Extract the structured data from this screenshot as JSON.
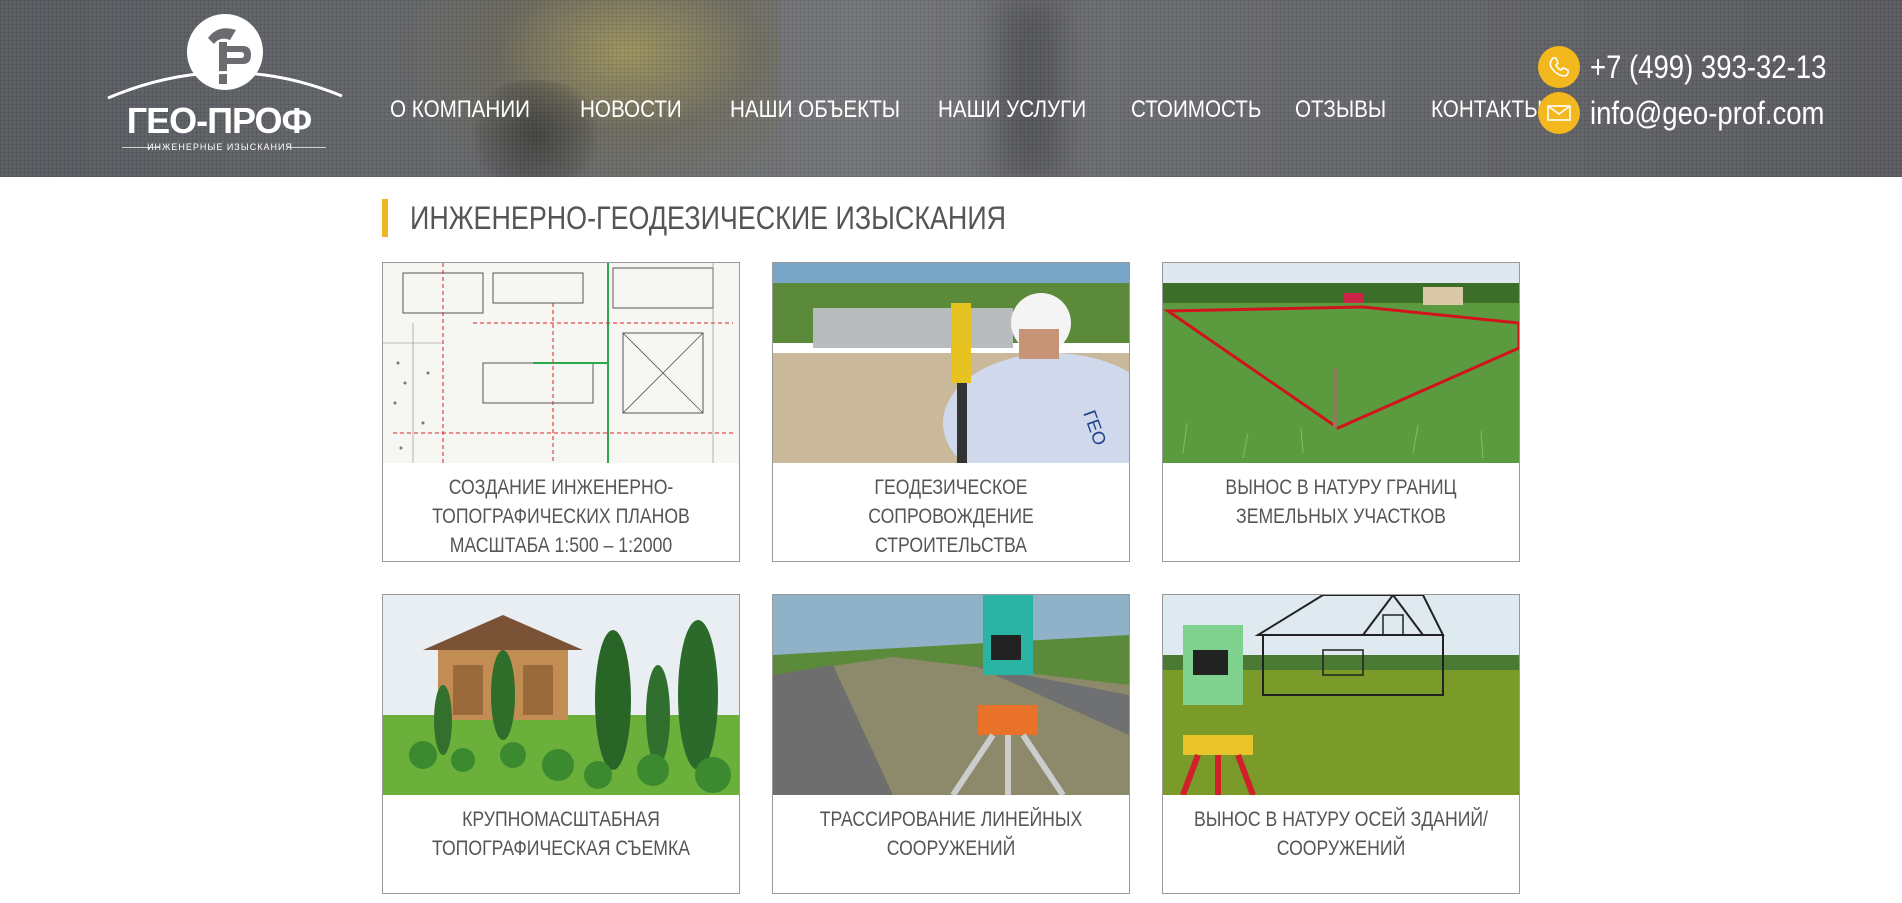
{
  "site": {
    "logo_text": "ГЕО-ПРОФ",
    "logo_subtitle": "ИНЖЕНЕРНЫЕ ИЗЫСКАНИЯ"
  },
  "nav": {
    "items": [
      {
        "label": "О КОМПАНИИ"
      },
      {
        "label": "НОВОСТИ"
      },
      {
        "label": "НАШИ ОБЪЕКТЫ"
      },
      {
        "label": "НАШИ УСЛУГИ"
      },
      {
        "label": "СТОИМОСТЬ"
      },
      {
        "label": "ОТЗЫВЫ"
      },
      {
        "label": "КОНТАКТЫ"
      }
    ]
  },
  "contacts": {
    "phone": "+7 (499) 393-32-13",
    "email": "info@geo-prof.com",
    "icon_color": "#f4b81f"
  },
  "main": {
    "title": "ИНЖЕНЕРНО-ГЕОДЕЗИЧЕСКИЕ ИЗЫСКАНИЯ",
    "accent_color": "#f0b522",
    "cards": [
      {
        "caption": "СОЗДАНИЕ ИНЖЕНЕРНО-ТОПОГРАФИЧЕСКИХ ПЛАНОВ МАСШТАБА 1:500 – 1:2000",
        "image": "topographic-plan-image"
      },
      {
        "caption": "ГЕОДЕЗИЧЕСКОЕ СОПРОВОЖДЕНИЕ СТРОИТЕЛЬСТВА",
        "image": "surveyor-with-instrument-image"
      },
      {
        "caption": "ВЫНОС В НАТУРУ ГРАНИЦ ЗЕМЕЛЬНЫХ УЧАСТКОВ",
        "image": "land-plot-boundary-image"
      },
      {
        "caption": "КРУПНОМАСШТАБНАЯ ТОПОГРАФИЧЕСКАЯ СЪЕМКА",
        "image": "garden-gazebo-image"
      },
      {
        "caption": "ТРАССИРОВАНИЕ ЛИНЕЙНЫХ СООРУЖЕНИЙ",
        "image": "road-theodolite-image"
      },
      {
        "caption": "ВЫНОС В НАТУРУ ОСЕЙ ЗДАНИЙ/СООРУЖЕНИЙ",
        "image": "house-outline-total-station-image"
      }
    ]
  }
}
